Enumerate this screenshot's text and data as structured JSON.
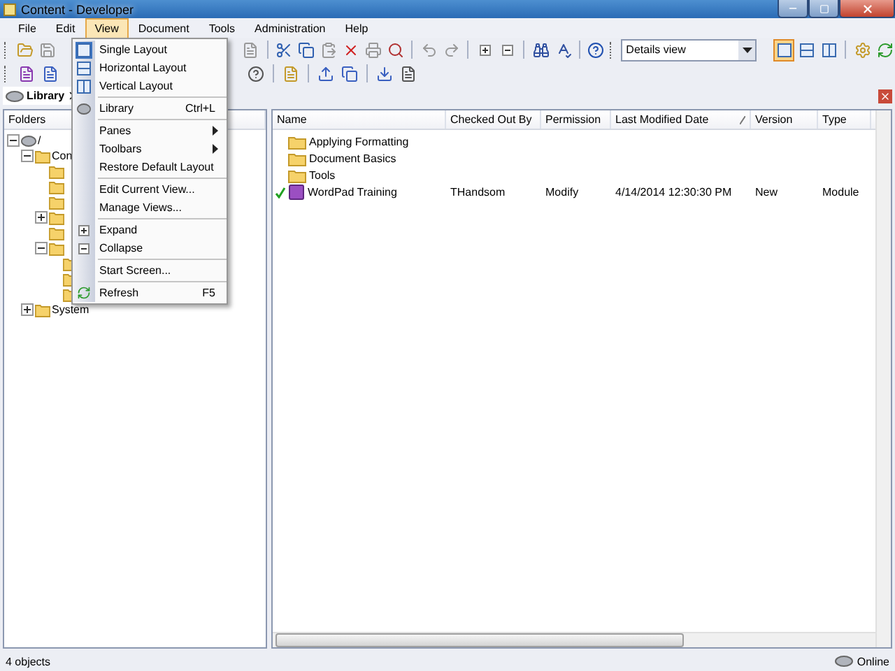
{
  "window": {
    "title": "Content - Developer"
  },
  "menu_bar": [
    {
      "label": "File",
      "selected": false
    },
    {
      "label": "Edit",
      "selected": false
    },
    {
      "label": "View",
      "selected": true
    },
    {
      "label": "Document",
      "selected": false
    },
    {
      "label": "Tools",
      "selected": false
    },
    {
      "label": "Administration",
      "selected": false
    },
    {
      "label": "Help",
      "selected": false
    }
  ],
  "view_menu": [
    {
      "kind": "item",
      "label": "Single Layout",
      "checked": true
    },
    {
      "kind": "item",
      "label": "Horizontal Layout",
      "checked": false
    },
    {
      "kind": "item",
      "label": "Vertical Layout",
      "checked": false
    },
    {
      "kind": "separator"
    },
    {
      "kind": "item",
      "label": "Library",
      "shortcut": "Ctrl+L",
      "checked": false
    },
    {
      "kind": "separator"
    },
    {
      "kind": "submenu",
      "label": "Panes"
    },
    {
      "kind": "submenu",
      "label": "Toolbars"
    },
    {
      "kind": "item",
      "label": "Restore Default Layout",
      "checked": false
    },
    {
      "kind": "separator"
    },
    {
      "kind": "item",
      "label": "Edit Current View...",
      "checked": false
    },
    {
      "kind": "item",
      "label": "Manage Views...",
      "checked": false
    },
    {
      "kind": "separator"
    },
    {
      "kind": "item",
      "label": "Expand",
      "checked": false
    },
    {
      "kind": "item",
      "label": "Collapse",
      "checked": false
    },
    {
      "kind": "separator"
    },
    {
      "kind": "item",
      "label": "Start Screen...",
      "checked": false
    },
    {
      "kind": "separator"
    },
    {
      "kind": "item",
      "label": "Refresh",
      "shortcut": "F5",
      "checked": false
    }
  ],
  "toolbar": {
    "view_selector": {
      "value": "Details view"
    },
    "layout_buttons": [
      {
        "selected": true
      },
      {
        "selected": false
      },
      {
        "selected": false
      }
    ]
  },
  "tabs": [
    {
      "label": "Library",
      "selected": true
    }
  ],
  "folders_pane": {
    "header": "Folders",
    "tree": [
      {
        "kind": "drive",
        "label": "/",
        "expanded": true,
        "children": [
          {
            "kind": "folder",
            "label": "Con",
            "expanded": true,
            "children": [
              {
                "kind": "folder"
              },
              {
                "kind": "folder"
              },
              {
                "kind": "folder"
              },
              {
                "kind": "folder",
                "expanded": false
              },
              {
                "kind": "folder"
              },
              {
                "kind": "folder",
                "expanded": true,
                "children": [
                  {
                    "kind": "folder"
                  },
                  {
                    "kind": "folder"
                  },
                  {
                    "kind": "folder"
                  }
                ]
              }
            ]
          },
          {
            "kind": "folder",
            "label": "System",
            "expanded": false
          }
        ]
      }
    ]
  },
  "content_pane": {
    "columns": [
      {
        "label": "Name",
        "sorted": false
      },
      {
        "label": "Checked Out By",
        "sorted": false
      },
      {
        "label": "Permission",
        "sorted": false
      },
      {
        "label": "Last Modified Date",
        "sorted": true
      },
      {
        "label": "Version",
        "sorted": false
      },
      {
        "label": "Type",
        "sorted": false
      }
    ],
    "rows": [
      {
        "kind": "folder",
        "checked_out": false,
        "cells": [
          "Applying Formatting"
        ]
      },
      {
        "kind": "folder",
        "checked_out": false,
        "cells": [
          "Document Basics"
        ]
      },
      {
        "kind": "folder",
        "checked_out": false,
        "cells": [
          "Tools"
        ]
      },
      {
        "kind": "module",
        "checked_out": true,
        "cells": [
          "WordPad Training",
          "THandsom",
          "Modify",
          "4/14/2014 12:30:30 PM",
          "New",
          "Module"
        ]
      }
    ]
  },
  "status_bar": {
    "count": "4 objects",
    "connection": "Online"
  }
}
